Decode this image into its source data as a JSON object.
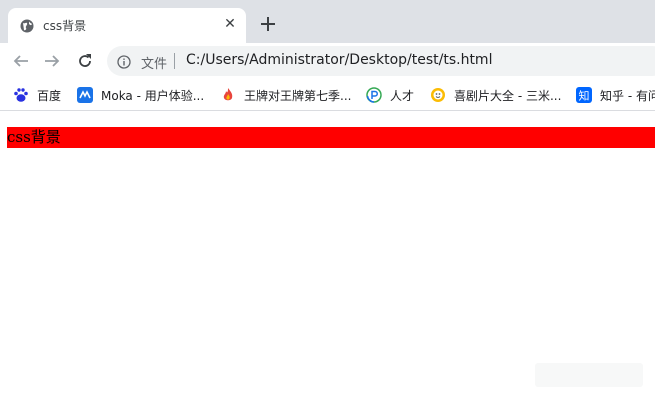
{
  "tab": {
    "title": "css背景",
    "close_glyph": "✕",
    "favicon_icon": "globe-icon"
  },
  "toolbar": {
    "back_icon": "arrow-left-icon",
    "forward_icon": "arrow-right-icon",
    "reload_icon": "reload-icon",
    "file_label": "文件",
    "url": "C:/Users/Administrator/Desktop/test/ts.html"
  },
  "bookmarks": [
    {
      "label": "百度",
      "icon": "baidu-paw-icon",
      "color": "#2932e1"
    },
    {
      "label": "Moka - 用户体验...",
      "icon": "moka-icon",
      "color": "#1a73e8"
    },
    {
      "label": "王牌对王牌第七季...",
      "icon": "flame-icon",
      "color": "#e8453c"
    },
    {
      "label": "人才",
      "icon": "p-circle-icon",
      "color": "#34a853"
    },
    {
      "label": "喜剧片大全 - 三米...",
      "icon": "smile-icon",
      "color": "#fbbc04"
    },
    {
      "label": "知乎 - 有问",
      "icon": "zhihu-icon",
      "color": "#0066ff"
    }
  ],
  "page": {
    "box_text": "css背景",
    "box_color": "#ff0000"
  }
}
